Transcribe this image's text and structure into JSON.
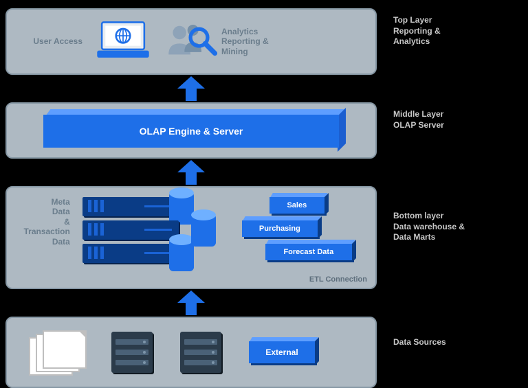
{
  "layers": {
    "top": {
      "side1": "Top Layer",
      "side2": "Reporting &",
      "side3": "Analytics",
      "user_access": "User Access",
      "analytics1": "Analytics",
      "analytics2": "Reporting &",
      "analytics3": "Mining"
    },
    "middle": {
      "side1": "Middle Layer",
      "side2": "OLAP Server",
      "olap_label": "OLAP Engine & Server"
    },
    "bottom": {
      "side1": "Bottom layer",
      "side2": "Data warehouse &",
      "side3": "Data Marts",
      "meta1": "Meta",
      "meta2": "Data",
      "meta3": "&",
      "meta4": "Transaction",
      "meta5": "Data",
      "mart_sales": "Sales",
      "mart_purch": "Purchasing",
      "mart_forecast": "Forecast Data",
      "etl": "ETL Connection"
    },
    "sources": {
      "side1": "Data Sources",
      "external": "External"
    }
  }
}
